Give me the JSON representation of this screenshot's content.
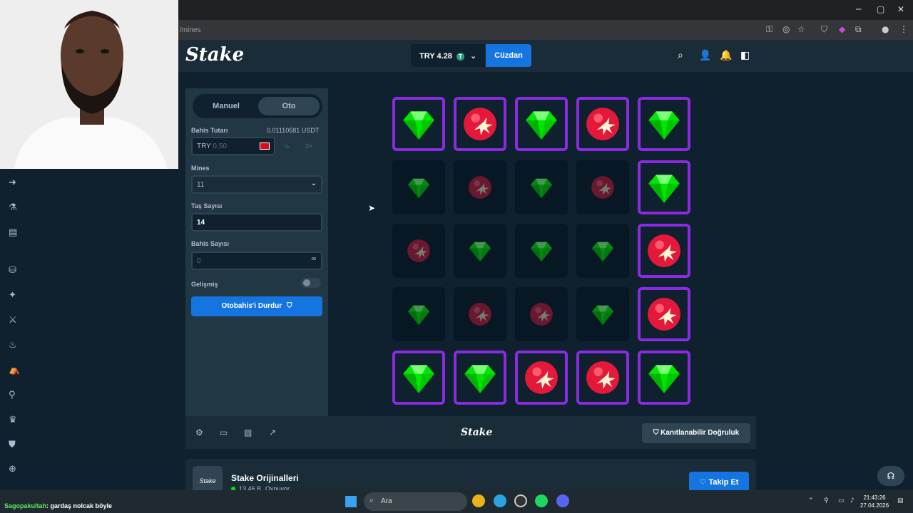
{
  "browser": {
    "url": "/mines",
    "minimize": "─",
    "maximize": "▢",
    "close": "✕"
  },
  "header": {
    "logo": "Stake",
    "balance": "TRY 4.28",
    "currency_coin": "T",
    "wallet_button": "Cüzdan"
  },
  "controls": {
    "tab_manual": "Manuel",
    "tab_auto": "Oto",
    "bet_amount_label": "Bahis Tutarı",
    "bet_amount_usdt": "0.01110581 USDT",
    "bet_currency": "TRY",
    "bet_value": "0,50",
    "half_label": "½",
    "double_label": "2×",
    "mines_label": "Mines",
    "mines_value": "11",
    "gems_label": "Taş Sayısı",
    "gems_value": "14",
    "bet_count_label": "Bahis Sayısı",
    "bet_count_value": "0",
    "advanced_label": "Gelişmiş",
    "stop_autobet": "Otobahis'i Durdur"
  },
  "board": {
    "rows": [
      [
        {
          "type": "gem",
          "revealed": true
        },
        {
          "type": "mine",
          "revealed": true
        },
        {
          "type": "gem",
          "revealed": true
        },
        {
          "type": "mine",
          "revealed": true
        },
        {
          "type": "gem",
          "revealed": true
        }
      ],
      [
        {
          "type": "gem",
          "revealed": false
        },
        {
          "type": "mine",
          "revealed": false
        },
        {
          "type": "gem",
          "revealed": false
        },
        {
          "type": "mine",
          "revealed": false
        },
        {
          "type": "gem",
          "revealed": true
        }
      ],
      [
        {
          "type": "mine",
          "revealed": false
        },
        {
          "type": "gem",
          "revealed": false
        },
        {
          "type": "gem",
          "revealed": false
        },
        {
          "type": "gem",
          "revealed": false
        },
        {
          "type": "mine",
          "revealed": true
        }
      ],
      [
        {
          "type": "gem",
          "revealed": false
        },
        {
          "type": "mine",
          "revealed": false
        },
        {
          "type": "mine",
          "revealed": false
        },
        {
          "type": "gem",
          "revealed": false
        },
        {
          "type": "mine",
          "revealed": true
        }
      ],
      [
        {
          "type": "gem",
          "revealed": true
        },
        {
          "type": "gem",
          "revealed": true
        },
        {
          "type": "mine",
          "revealed": true
        },
        {
          "type": "mine",
          "revealed": true
        },
        {
          "type": "gem",
          "revealed": true
        }
      ]
    ]
  },
  "footer": {
    "logo": "Stake",
    "fairness": "Kanıtlanabilir Doğruluk"
  },
  "originals": {
    "title": "Stake Orijinalleri",
    "badge": "Stake",
    "players": "13,46 B",
    "players_label": "Oynuyor",
    "follow": "Takip Et"
  },
  "taskbar": {
    "chat_user": "Sagopakultah",
    "chat_text": ": gardaş nolcak böyle",
    "search": "Ara",
    "time": "21:43:26",
    "date": "27.04.2026"
  },
  "colors": {
    "accent": "#1475e1",
    "revealed_border": "#8a2be2",
    "gem": "#00e701",
    "mine": "#e3183b"
  }
}
